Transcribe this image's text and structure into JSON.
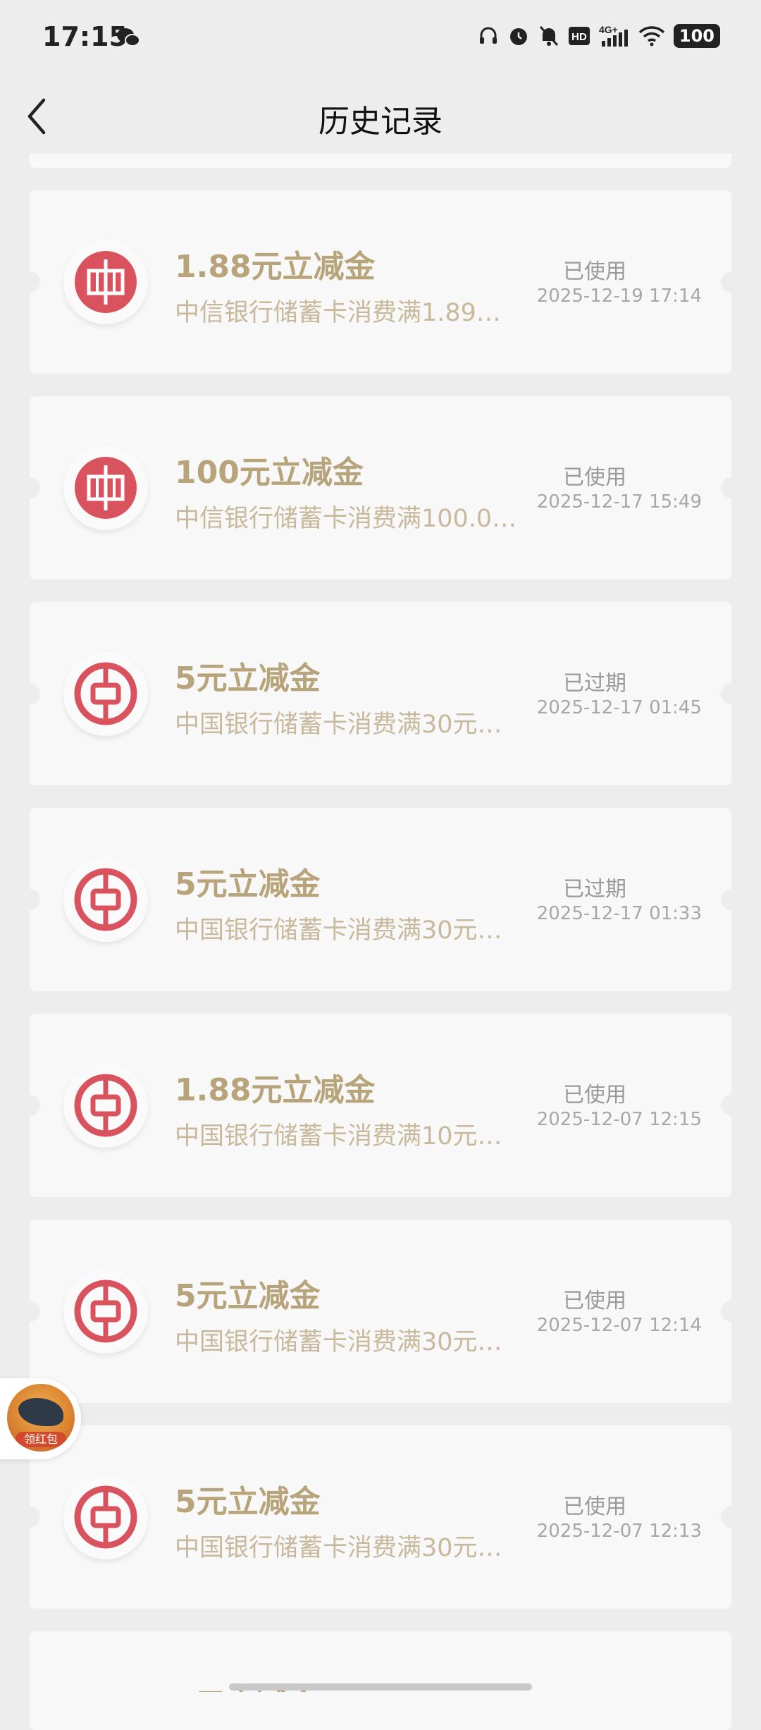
{
  "status_bar": {
    "time": "17:15",
    "icons": [
      "wechat-icon",
      "headphones-icon",
      "alarm-icon",
      "mute-bell-icon",
      "hd-icon",
      "4g-signal-icon",
      "wifi-icon"
    ],
    "battery": "100"
  },
  "header": {
    "title": "历史记录"
  },
  "records": [
    {
      "bank": "citic",
      "title": "1.88元立减金",
      "description": "中信银行储蓄卡消费满1.89…",
      "status": "已使用",
      "time": "2025-12-19 17:14"
    },
    {
      "bank": "citic",
      "title": "100元立减金",
      "description": "中信银行储蓄卡消费满100.0…",
      "status": "已使用",
      "time": "2025-12-17 15:49"
    },
    {
      "bank": "boc",
      "title": "5元立减金",
      "description": "中国银行储蓄卡消费满30元…",
      "status": "已过期",
      "time": "2025-12-17 01:45"
    },
    {
      "bank": "boc",
      "title": "5元立减金",
      "description": "中国银行储蓄卡消费满30元…",
      "status": "已过期",
      "time": "2025-12-17 01:33"
    },
    {
      "bank": "boc",
      "title": "1.88元立减金",
      "description": "中国银行储蓄卡消费满10元…",
      "status": "已使用",
      "time": "2025-12-07 12:15"
    },
    {
      "bank": "boc",
      "title": "5元立减金",
      "description": "中国银行储蓄卡消费满30元…",
      "status": "已使用",
      "time": "2025-12-07 12:14"
    },
    {
      "bank": "boc",
      "title": "5元立减金",
      "description": "中国银行储蓄卡消费满30元…",
      "status": "已使用",
      "time": "2025-12-07 12:13"
    }
  ],
  "partial_record": {
    "title": "5元立减金"
  },
  "floating_badge": {
    "label": "领红包",
    "icon": "red-packet-dragon-icon"
  },
  "colors": {
    "accent_title": "#b8a47a",
    "bank_red": "#d9535f",
    "background": "#ededed",
    "card": "#f8f8f8"
  }
}
